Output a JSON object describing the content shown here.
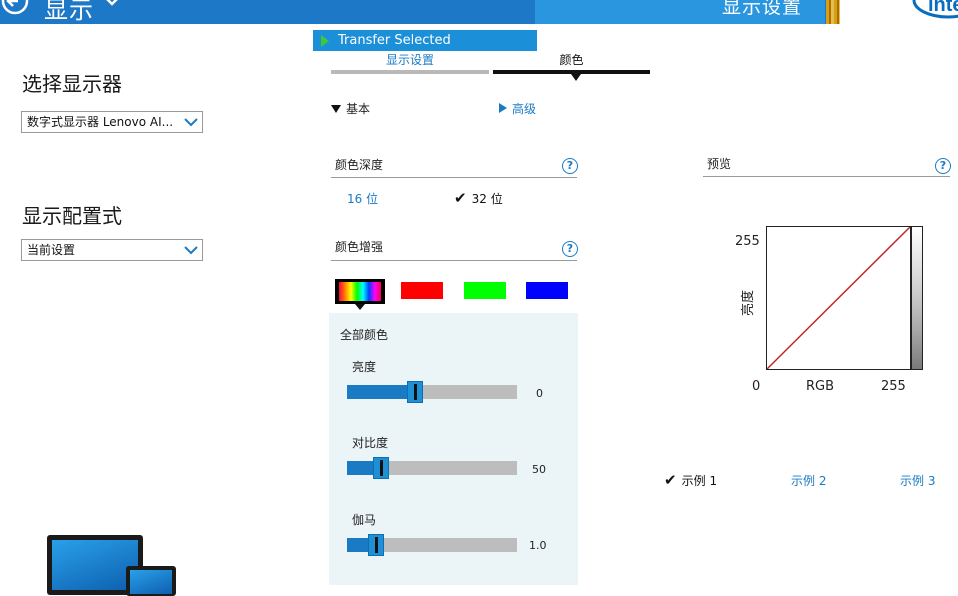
{
  "header": {
    "title": "显示",
    "right_title": "显示设置",
    "logo_text": "intel"
  },
  "transfer_bar": {
    "label": "Transfer Selected"
  },
  "left_panel": {
    "select_display": {
      "title": "选择显示器",
      "value": "数字式显示器 Lenovo AI..."
    },
    "display_profile": {
      "title": "显示配置式",
      "value": "当前设置"
    }
  },
  "tabs": [
    {
      "label": "显示设置",
      "active": false
    },
    {
      "label": "颜色",
      "active": true
    }
  ],
  "mode": {
    "basic": "基本",
    "advanced": "高级"
  },
  "color_depth": {
    "title": "颜色深度",
    "options": [
      {
        "label": "16 位",
        "selected": false
      },
      {
        "label": "32 位",
        "selected": true
      }
    ]
  },
  "color_enhance": {
    "title": "颜色增强",
    "swatches": [
      {
        "name": "all",
        "color": "rainbow",
        "selected": true
      },
      {
        "name": "red",
        "color": "#ff0000",
        "selected": false
      },
      {
        "name": "green",
        "color": "#00ff00",
        "selected": false
      },
      {
        "name": "blue",
        "color": "#0000ff",
        "selected": false
      }
    ],
    "panel_title": "全部颜色",
    "sliders": [
      {
        "label": "亮度",
        "value": "0",
        "position": 0.4
      },
      {
        "label": "对比度",
        "value": "50",
        "position": 0.2
      },
      {
        "label": "伽马",
        "value": "1.0",
        "position": 0.17
      }
    ]
  },
  "preview": {
    "title": "预览",
    "chart_data": {
      "type": "line",
      "series": [
        {
          "name": "",
          "x": [
            0,
            255
          ],
          "y": [
            0,
            255
          ]
        }
      ],
      "xlabel": "RGB",
      "ylabel": "亮度",
      "x_ticks": [
        "0",
        "255"
      ],
      "y_ticks": [
        "255"
      ],
      "xlim": [
        0,
        255
      ],
      "ylim": [
        0,
        255
      ],
      "line_color": "#c0282a"
    },
    "examples": [
      {
        "label": "示例 1",
        "selected": true
      },
      {
        "label": "示例 2",
        "selected": false
      },
      {
        "label": "示例 3",
        "selected": false
      }
    ]
  },
  "help_glyph": "?",
  "check_glyph": "✔"
}
